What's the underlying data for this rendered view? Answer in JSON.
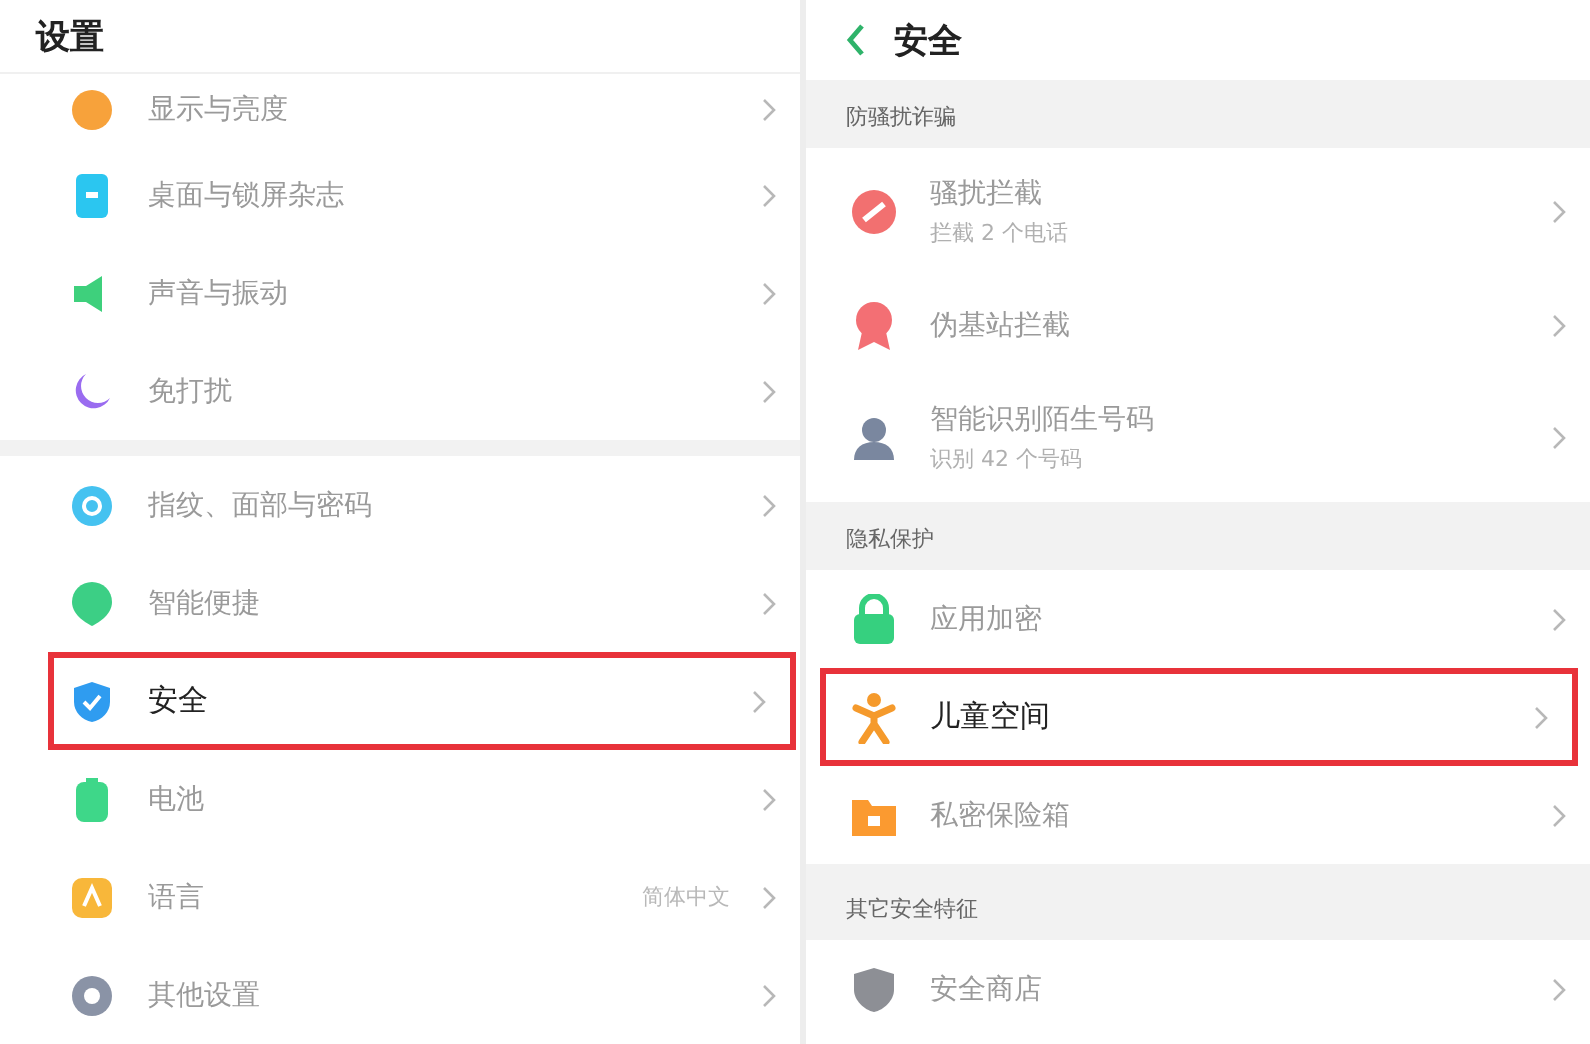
{
  "settings": {
    "title": "设置",
    "groups": [
      {
        "items": [
          {
            "label": "显示与亮度",
            "highlighted": false
          },
          {
            "label": "桌面与锁屏杂志",
            "highlighted": false
          },
          {
            "label": "声音与振动",
            "highlighted": false
          },
          {
            "label": "免打扰",
            "highlighted": false
          }
        ]
      },
      {
        "items": [
          {
            "label": "指纹、面部与密码",
            "highlighted": false
          },
          {
            "label": "智能便捷",
            "highlighted": false
          },
          {
            "label": "安全",
            "highlighted": true
          },
          {
            "label": "电池",
            "highlighted": false
          },
          {
            "label": "语言",
            "value": "简体中文",
            "highlighted": false
          },
          {
            "label": "其他设置",
            "highlighted": false
          }
        ]
      }
    ]
  },
  "security": {
    "title": "安全",
    "sections": [
      {
        "header": "防骚扰诈骗",
        "items": [
          {
            "label": "骚扰拦截",
            "subtitle": "拦截 2 个电话",
            "highlighted": false
          },
          {
            "label": "伪基站拦截",
            "highlighted": false
          },
          {
            "label": "智能识别陌生号码",
            "subtitle": "识别 42 个号码",
            "highlighted": false
          }
        ]
      },
      {
        "header": "隐私保护",
        "items": [
          {
            "label": "应用加密",
            "highlighted": false
          },
          {
            "label": "儿童空间",
            "highlighted": true
          },
          {
            "label": "私密保险箱",
            "highlighted": false
          }
        ]
      },
      {
        "header": "其它安全特征",
        "items": [
          {
            "label": "安全商店",
            "highlighted": false
          }
        ]
      }
    ]
  }
}
